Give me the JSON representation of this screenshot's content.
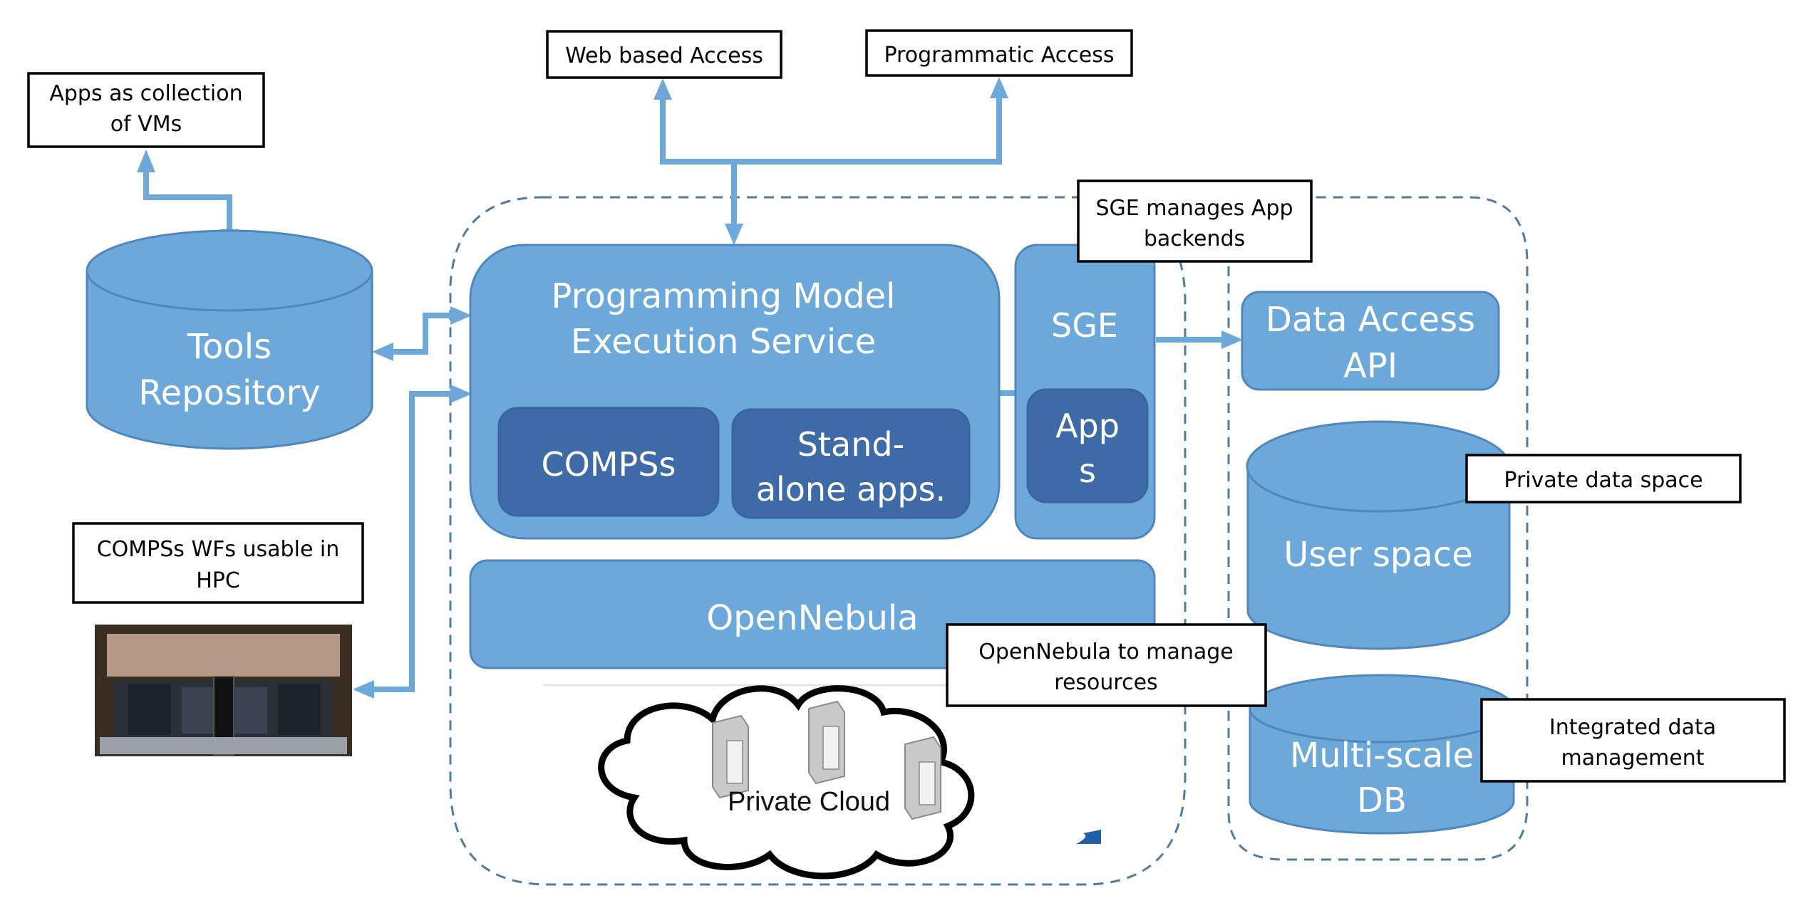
{
  "callouts": {
    "apps_vms": [
      "Apps as collection",
      "of VMs"
    ],
    "web_access": "Web based Access",
    "programmatic_access": "Programmatic Access",
    "sge_manages": [
      "SGE manages App",
      "backends"
    ],
    "compss_hpc": [
      "COMPSs WFs usable in",
      "HPC"
    ],
    "opennebula_manage": [
      "OpenNebula to manage",
      "resources"
    ],
    "private_data": "Private data space",
    "integrated_data": [
      "Integrated data",
      "management"
    ]
  },
  "components": {
    "tools_repository": [
      "Tools",
      "Repository"
    ],
    "pmes": [
      "Programming Model",
      "Execution Service"
    ],
    "compss": "COMPSs",
    "standalone": [
      "Stand-",
      "alone apps."
    ],
    "sge": "SGE",
    "apps": [
      "App",
      "s"
    ],
    "opennebula": "OpenNebula",
    "private_cloud": "Private Cloud",
    "data_access_api": [
      "Data Access",
      "API"
    ],
    "user_space": "User space",
    "multiscale_db": [
      "Multi-scale",
      "DB"
    ]
  },
  "colors": {
    "component_fill": "#6CA9DA",
    "component_border": "#4F86BE",
    "inner_fill": "#3E6AA8",
    "dashed_border": "#4E7BA6",
    "arrow": "#6CA9DA"
  }
}
